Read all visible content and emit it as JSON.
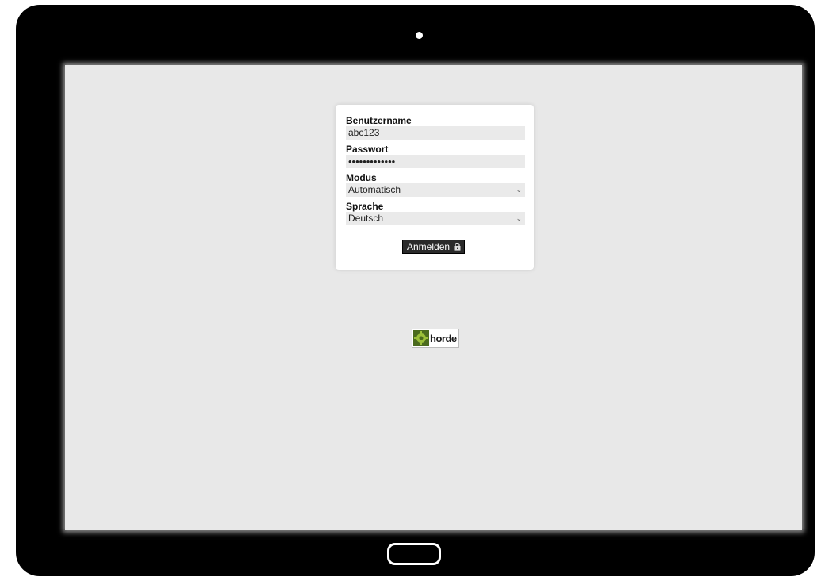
{
  "login": {
    "username_label": "Benutzername",
    "username_value": "abc123",
    "password_label": "Passwort",
    "password_value": "•••••••••••••",
    "mode_label": "Modus",
    "mode_value": "Automatisch",
    "language_label": "Sprache",
    "language_value": "Deutsch",
    "submit_label": "Anmelden"
  },
  "logo": {
    "text": "horde"
  },
  "icons": {
    "camera": "camera-icon",
    "home": "home-button-icon",
    "dropdown": "chevron-down-icon",
    "lock": "lock-icon"
  }
}
